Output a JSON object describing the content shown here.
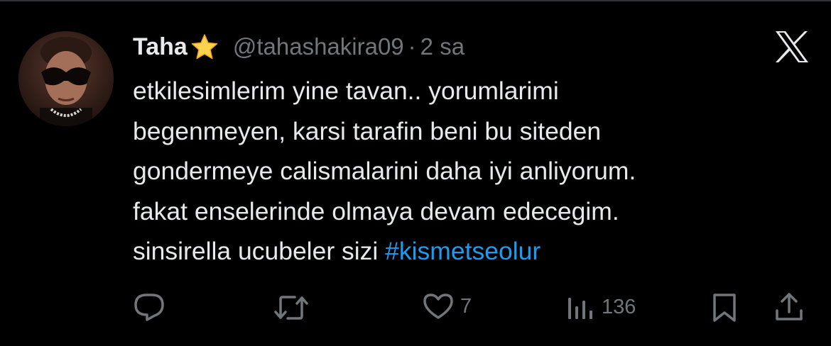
{
  "tweet": {
    "name": "Taha",
    "badge_icon": "star-emoji",
    "handle": "@tahashakira09",
    "separator": "·",
    "time": "2 sa",
    "text_lines": [
      "etkilesimlerim yine tavan.. yorumlarimi",
      "begenmeyen, karsi tarafin beni bu siteden",
      "gondermeye calismalarini daha iyi anliyorum.",
      "fakat enselerinde olmaya devam edecegim.",
      "sinsirella ucubeler sizi"
    ],
    "hashtag": "#kismetseolur"
  },
  "actions": {
    "reply_icon": "reply-icon",
    "retweet_icon": "retweet-icon",
    "like_icon": "heart-icon",
    "like_count": "7",
    "views_icon": "views-icon",
    "views_count": "136",
    "bookmark_icon": "bookmark-icon",
    "share_icon": "share-icon"
  },
  "brand": {
    "logo": "x-logo",
    "hashtag_color": "#1d9bf0",
    "muted_color": "#71767b",
    "text_color": "#e7e9ea"
  }
}
